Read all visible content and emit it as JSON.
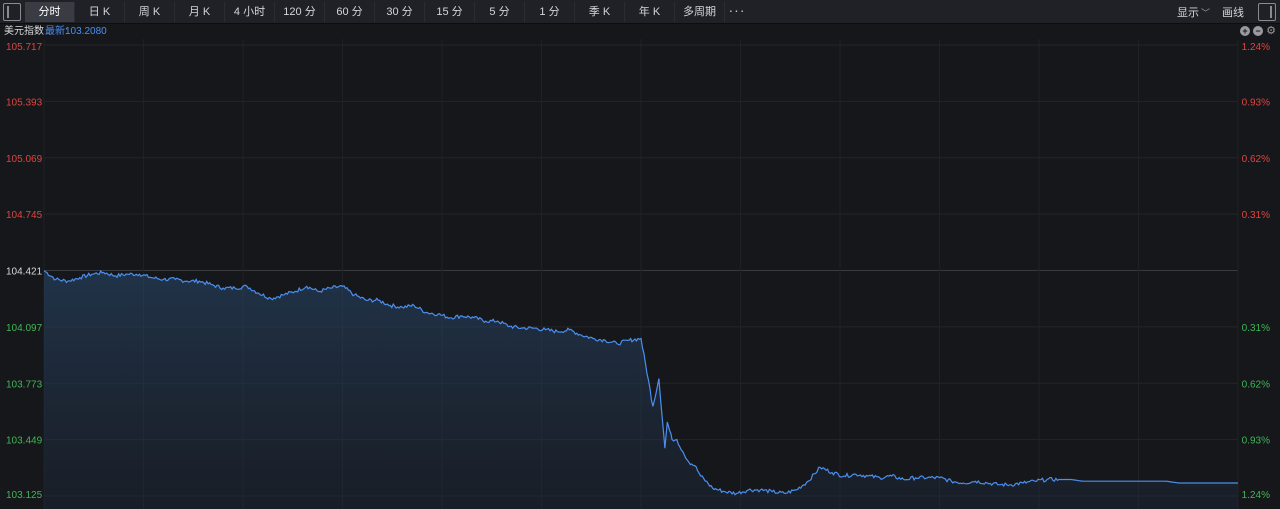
{
  "toolbar": {
    "tabs": [
      {
        "label": "分时",
        "w": 50
      },
      {
        "label": "日 K",
        "w": 50
      },
      {
        "label": "周 K",
        "w": 50
      },
      {
        "label": "月 K",
        "w": 50
      },
      {
        "label": "4 小时",
        "w": 50
      },
      {
        "label": "120 分",
        "w": 50
      },
      {
        "label": "60 分",
        "w": 50
      },
      {
        "label": "30 分",
        "w": 50
      },
      {
        "label": "15 分",
        "w": 50
      },
      {
        "label": "5 分",
        "w": 50
      },
      {
        "label": "1 分",
        "w": 50
      },
      {
        "label": "季 K",
        "w": 50
      },
      {
        "label": "年 K",
        "w": 50
      },
      {
        "label": "多周期",
        "w": 50
      }
    ],
    "active_tab": "分时",
    "display_label": "显示",
    "draw_label": "画线"
  },
  "header": {
    "index_name": "美元指数",
    "latest_label": "最新:",
    "latest_value": "103.2080"
  },
  "colors": {
    "up": "#e0443e",
    "down": "#3fb655",
    "neutral": "#d8d9dc",
    "line": "#4a8ff0",
    "background": "#16171b"
  },
  "chart_data": {
    "type": "line",
    "reference_price": 104.421,
    "y_tick_labels": [
      "105.717",
      "105.393",
      "105.069",
      "104.745",
      "104.421",
      "104.097",
      "103.773",
      "103.449",
      "103.125"
    ],
    "y_right_tick_labels": [
      "1.24%",
      "0.93%",
      "0.62%",
      "0.31%",
      "",
      "0.31%",
      "0.62%",
      "0.93%",
      "1.24%"
    ],
    "ylim": [
      103.125,
      105.717
    ],
    "grid": true,
    "series": [
      {
        "x_fraction": [
          0.0,
          0.01,
          0.02,
          0.03,
          0.04,
          0.05,
          0.06,
          0.07,
          0.08,
          0.09,
          0.1,
          0.11,
          0.12,
          0.13,
          0.14,
          0.15,
          0.16,
          0.17,
          0.18,
          0.19,
          0.2,
          0.21,
          0.22,
          0.23,
          0.24,
          0.25,
          0.26,
          0.27,
          0.28,
          0.29,
          0.3,
          0.31,
          0.32,
          0.33,
          0.34,
          0.35,
          0.36,
          0.37,
          0.38,
          0.39,
          0.4,
          0.41,
          0.42,
          0.43,
          0.44,
          0.45,
          0.46,
          0.47,
          0.48,
          0.49,
          0.5,
          0.51,
          0.515,
          0.52,
          0.522,
          0.524,
          0.526,
          0.53,
          0.535,
          0.54,
          0.545,
          0.55,
          0.56,
          0.57,
          0.58,
          0.59,
          0.6,
          0.61,
          0.62,
          0.63,
          0.64,
          0.65,
          0.66,
          0.67,
          0.68,
          0.69,
          0.7,
          0.71,
          0.72,
          0.73,
          0.74,
          0.75,
          0.76,
          0.77,
          0.78,
          0.79,
          0.8,
          0.81,
          0.82,
          0.83,
          0.84,
          0.85,
          0.86,
          0.87,
          0.88,
          0.89,
          0.9,
          0.91,
          0.92,
          0.93,
          0.94,
          0.95,
          0.96,
          0.97,
          0.98,
          0.99,
          1.0
        ],
        "values": [
          104.42,
          104.37,
          104.36,
          104.38,
          104.4,
          104.41,
          104.39,
          104.4,
          104.4,
          104.38,
          104.37,
          104.37,
          104.36,
          104.36,
          104.34,
          104.32,
          104.32,
          104.33,
          104.29,
          104.26,
          104.28,
          104.3,
          104.33,
          104.3,
          104.32,
          104.33,
          104.28,
          104.25,
          104.25,
          104.22,
          104.21,
          104.22,
          104.18,
          104.17,
          104.15,
          104.16,
          104.15,
          104.13,
          104.13,
          104.1,
          104.09,
          104.09,
          104.08,
          104.07,
          104.08,
          104.05,
          104.03,
          104.02,
          104.0,
          104.02,
          104.03,
          103.64,
          103.8,
          103.4,
          103.55,
          103.5,
          103.45,
          103.45,
          103.38,
          103.32,
          103.3,
          103.24,
          103.17,
          103.15,
          103.14,
          103.16,
          103.16,
          103.15,
          103.14,
          103.16,
          103.21,
          103.29,
          103.26,
          103.24,
          103.25,
          103.24,
          103.23,
          103.24,
          103.22,
          103.23,
          103.23,
          103.23,
          103.21,
          103.2,
          103.21,
          103.2,
          103.19,
          103.19,
          103.2,
          103.21,
          103.22,
          103.22,
          103.22,
          103.21,
          103.21,
          103.21,
          103.21,
          103.21,
          103.21,
          103.21,
          103.21,
          103.2,
          103.2,
          103.2,
          103.2,
          103.2,
          103.2
        ]
      }
    ]
  }
}
